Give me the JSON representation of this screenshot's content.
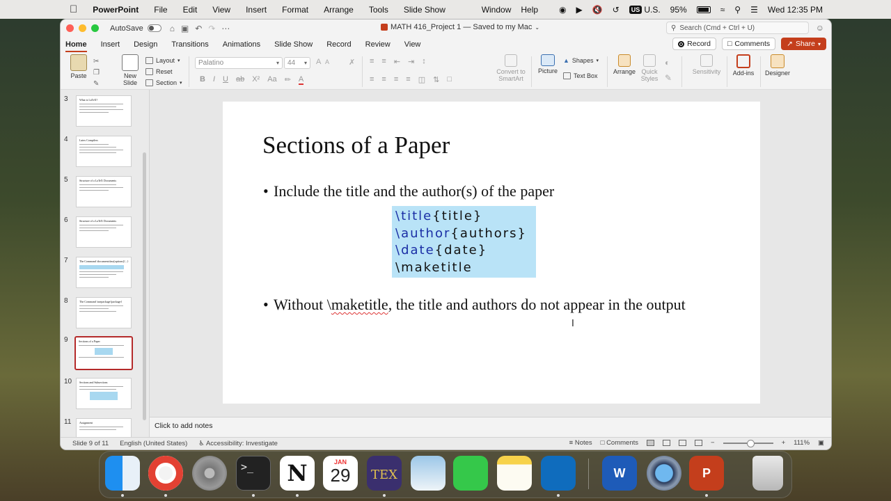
{
  "menubar": {
    "app_name": "PowerPoint",
    "items": [
      "File",
      "Edit",
      "View",
      "Insert",
      "Format",
      "Arrange",
      "Tools",
      "Slide Show"
    ],
    "right_items": [
      "Window",
      "Help"
    ],
    "input_source": "U.S.",
    "input_badge": "US",
    "battery": "95%",
    "clock": "Wed 12:35 PM"
  },
  "window": {
    "autosave_label": "AutoSave",
    "doc_title": "MATH 416_Project 1 — Saved to my Mac",
    "search_placeholder": "Search (Cmd + Ctrl + U)"
  },
  "tabs": [
    "Home",
    "Insert",
    "Design",
    "Transitions",
    "Animations",
    "Slide Show",
    "Record",
    "Review",
    "View"
  ],
  "tab_buttons": {
    "record": "Record",
    "comments": "Comments",
    "share": "Share"
  },
  "ribbon": {
    "paste": "Paste",
    "new_slide": "New Slide",
    "layout": "Layout",
    "reset": "Reset",
    "section": "Section",
    "font_name": "Palatino",
    "font_size": "44",
    "convert_smartart": "Convert to SmartArt",
    "picture": "Picture",
    "shapes": "Shapes",
    "text_box": "Text Box",
    "arrange": "Arrange",
    "quick_styles": "Quick Styles",
    "sensitivity": "Sensitivity",
    "add_ins": "Add-ins",
    "designer": "Designer"
  },
  "thumbnails": [
    {
      "num": "3",
      "title": "What is LaTeX?"
    },
    {
      "num": "4",
      "title": "Latex Compilers"
    },
    {
      "num": "5",
      "title": "Structure of a LaTeX Documents"
    },
    {
      "num": "6",
      "title": "Structure of a LaTeX Documents"
    },
    {
      "num": "7",
      "title": "The Command \\documentclass[options]{...}"
    },
    {
      "num": "8",
      "title": "The Command \\usepackage{package}"
    },
    {
      "num": "9",
      "title": "Sections of a Paper"
    },
    {
      "num": "10",
      "title": "Sections and Subsections"
    },
    {
      "num": "11",
      "title": "Assignment"
    }
  ],
  "slide": {
    "title": "Sections of a Paper",
    "bullet1": "Include the title and the author(s) of the paper",
    "code": [
      {
        "kw": "\\title",
        "arg": "{title}"
      },
      {
        "kw": "\\author",
        "arg": "{authors}"
      },
      {
        "kw": "\\date",
        "arg": "{date}"
      },
      {
        "kw": "",
        "arg": "\\maketitle"
      }
    ],
    "bullet2_pre": "Without \\",
    "bullet2_word": "maketitle",
    "bullet2_post": ", the title and authors do not appear in the output"
  },
  "notes_placeholder": "Click to add notes",
  "status": {
    "slide": "Slide 9 of 11",
    "language": "English (United States)",
    "accessibility": "Accessibility: Investigate",
    "notes": "Notes",
    "comments": "Comments",
    "zoom": "111%"
  },
  "dock": {
    "calendar_month": "JAN",
    "calendar_day": "29",
    "apps": [
      "Finder",
      "Chrome",
      "System Settings",
      "Terminal",
      "Notion",
      "Calendar",
      "TeXShop",
      "Preview",
      "Messages",
      "Notes",
      "Outlook",
      "Word",
      "QuickTime",
      "PowerPoint",
      "Trash"
    ]
  }
}
